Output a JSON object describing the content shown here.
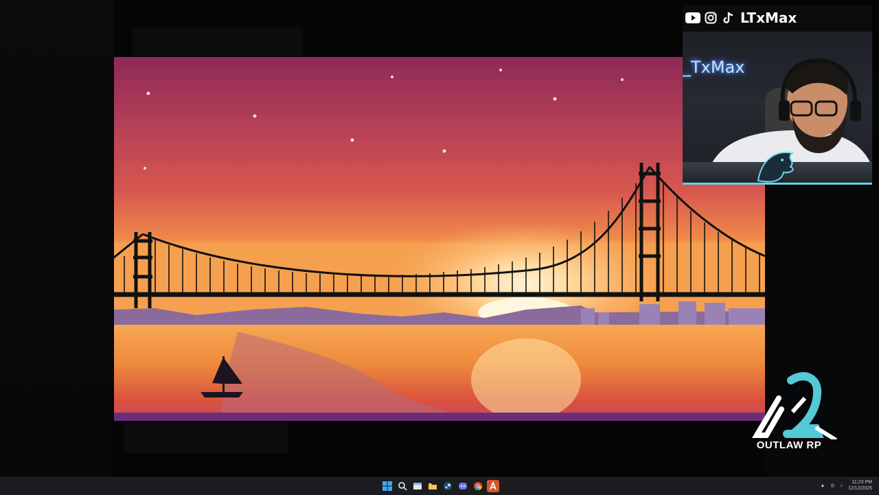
{
  "stream": {
    "handle": "LTxMax",
    "neon_sign": "_TxMax",
    "logo_text": "OUTLAW RP",
    "social_icons": [
      "youtube-icon",
      "instagram-icon",
      "tiktok-icon"
    ]
  },
  "taskbar": {
    "apps": [
      "windows-start-icon",
      "search-icon",
      "file-explorer-icon",
      "folder-icon",
      "steam-icon",
      "discord-icon",
      "chrome-icon",
      "paint-app-icon"
    ],
    "time": "11:23 PM",
    "date": "12/12/2025"
  },
  "colors": {
    "accent": "#5fd6e6",
    "sky_top": "#8e2a55",
    "sun": "#fff4d6",
    "bridge": "#111111"
  }
}
